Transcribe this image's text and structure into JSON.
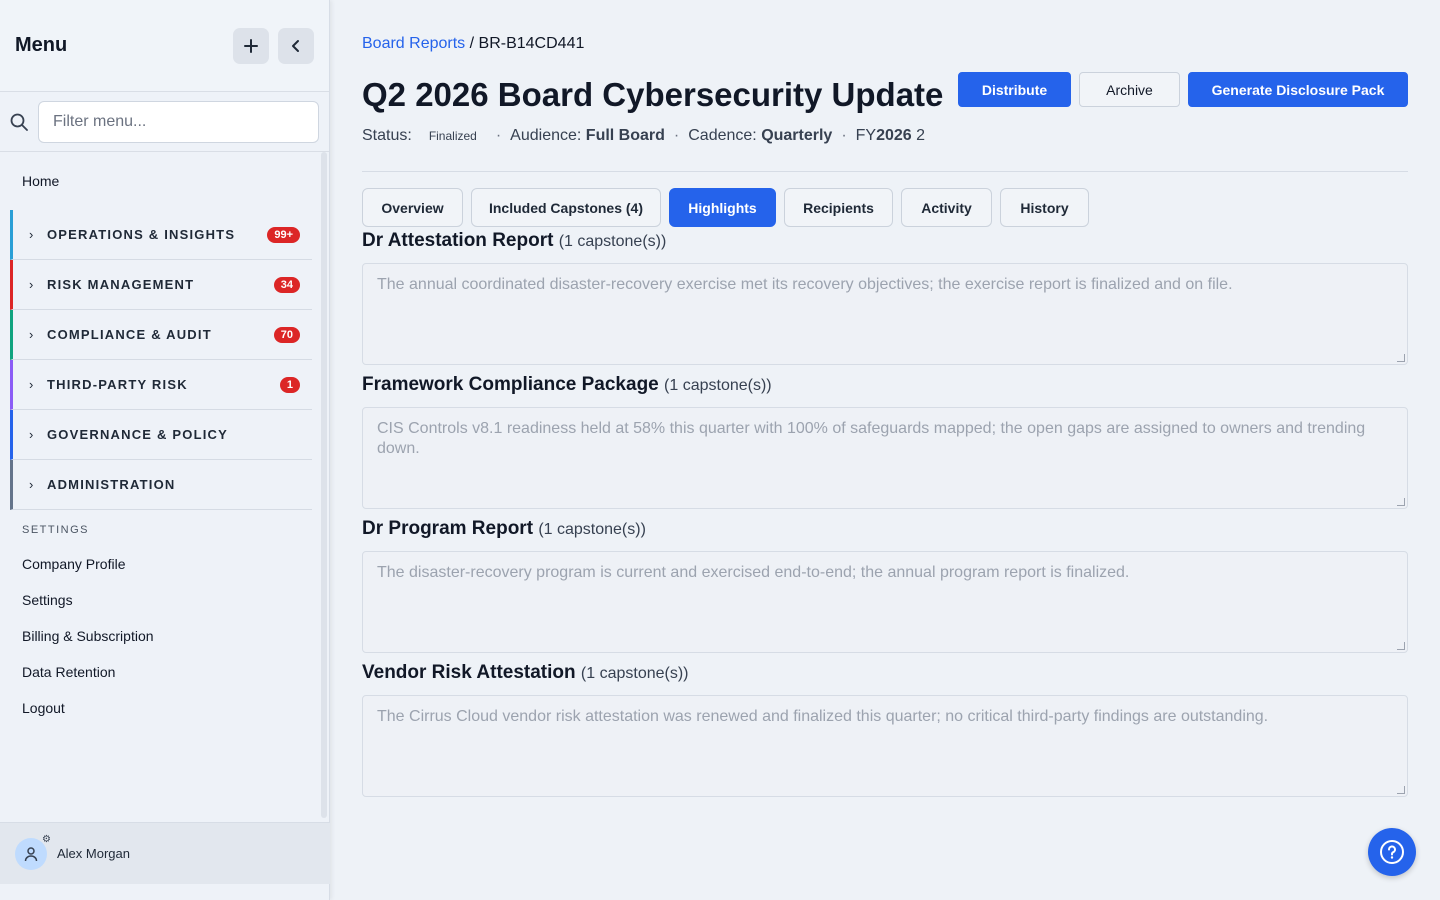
{
  "sidebar": {
    "title": "Menu",
    "filter_placeholder": "Filter menu...",
    "home": "Home",
    "groups": [
      {
        "label": "OPERATIONS & INSIGHTS",
        "badge": "99+",
        "color": "#2a9fd6"
      },
      {
        "label": "RISK MANAGEMENT",
        "badge": "34",
        "color": "#dc2626"
      },
      {
        "label": "COMPLIANCE & AUDIT",
        "badge": "70",
        "color": "#10a37f"
      },
      {
        "label": "THIRD-PARTY RISK",
        "badge": "1",
        "color": "#8b5cf6"
      },
      {
        "label": "GOVERNANCE & POLICY",
        "badge": "",
        "color": "#2563eb"
      },
      {
        "label": "ADMINISTRATION",
        "badge": "",
        "color": "#64748b"
      }
    ],
    "settings_label": "SETTINGS",
    "links": [
      "Company Profile",
      "Settings",
      "Billing & Subscription",
      "Data Retention",
      "Logout"
    ],
    "user": "Alex Morgan"
  },
  "breadcrumb": {
    "parent": "Board Reports",
    "separator": "/",
    "current": "BR-B14CD441"
  },
  "page": {
    "title": "Q2 2026 Board Cybersecurity Update",
    "actions": {
      "distribute": "Distribute",
      "archive": "Archive",
      "generate": "Generate Disclosure Pack"
    },
    "meta": {
      "status_label": "Status:",
      "status_value": "Finalized",
      "audience_label": "Audience:",
      "audience_value": "Full Board",
      "cadence_label": "Cadence:",
      "cadence_value": "Quarterly",
      "fy_prefix": "FY",
      "fy_value": "2026",
      "fy_suffix": "2",
      "sep": "·"
    }
  },
  "tabs": [
    "Overview",
    "Included Capstones (4)",
    "Highlights",
    "Recipients",
    "Activity",
    "History"
  ],
  "active_tab": "Highlights",
  "highlights": [
    {
      "title": "Dr Attestation Report",
      "count": "(1 capstone(s))",
      "text": "The annual coordinated disaster-recovery exercise met its recovery objectives; the exercise report is finalized and on file."
    },
    {
      "title": "Framework Compliance Package",
      "count": "(1 capstone(s))",
      "text": "CIS Controls v8.1 readiness held at 58% this quarter with 100% of safeguards mapped; the open gaps are assigned to owners and trending down."
    },
    {
      "title": "Dr Program Report",
      "count": "(1 capstone(s))",
      "text": "The disaster-recovery program is current and exercised end-to-end; the annual program report is finalized."
    },
    {
      "title": "Vendor Risk Attestation",
      "count": "(1 capstone(s))",
      "text": "The Cirrus Cloud vendor risk attestation was renewed and finalized this quarter; no critical third-party findings are outstanding."
    }
  ],
  "colors": {
    "accent": "#2563eb",
    "badge": "#dc2626"
  }
}
